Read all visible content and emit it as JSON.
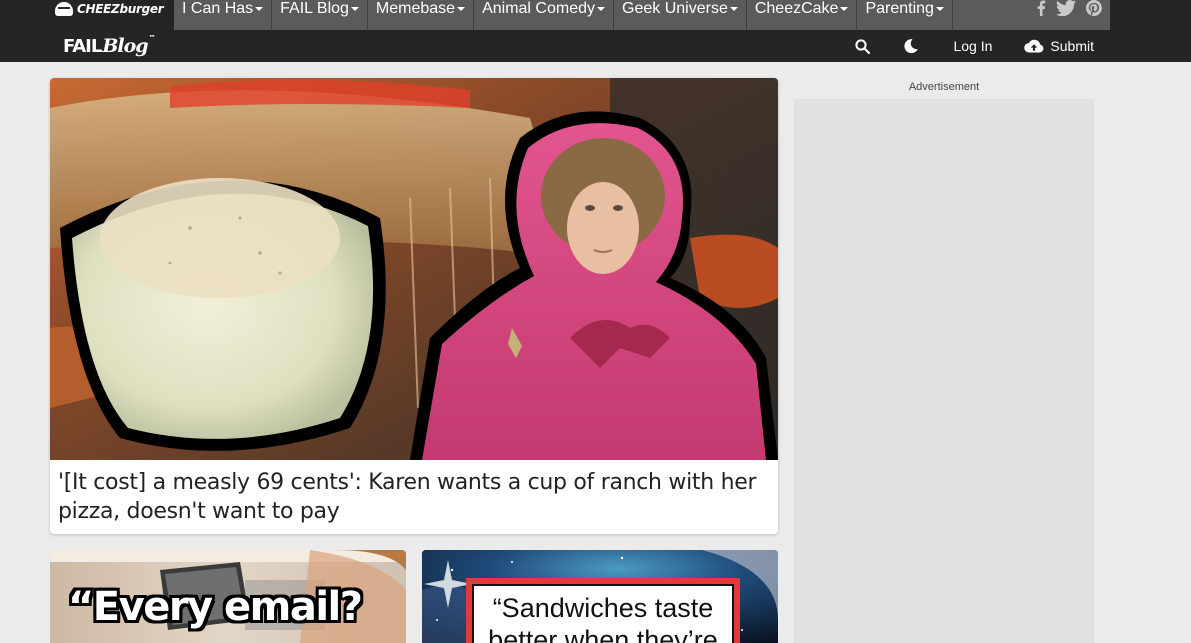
{
  "network": {
    "logo_text": "CHEEZburger",
    "items": [
      {
        "label": "I Can Has"
      },
      {
        "label": "FAIL Blog"
      },
      {
        "label": "Memebase"
      },
      {
        "label": "Animal Comedy"
      },
      {
        "label": "Geek Universe"
      },
      {
        "label": "CheezCake"
      },
      {
        "label": "Parenting"
      }
    ],
    "social_icons": [
      "facebook-icon",
      "twitter-icon",
      "pinterest-icon"
    ]
  },
  "header": {
    "logo_fail": "FAIL",
    "logo_blog": "Blog",
    "login_label": "Log In",
    "submit_label": "Submit"
  },
  "feature": {
    "title": "'[It cost] a measly 69 cents': Karen wants a cup of ranch with her pizza, doesn't want to pay"
  },
  "cards": [
    {
      "overlay_text": "“Every email?"
    },
    {
      "overlay_text": "“Sandwiches taste better when they’re"
    }
  ],
  "sidebar": {
    "ad_label": "Advertisement"
  },
  "colors": {
    "bar_dark": "#252525",
    "nav_gray": "#5b5b5b",
    "page_bg": "#ebebeb"
  }
}
